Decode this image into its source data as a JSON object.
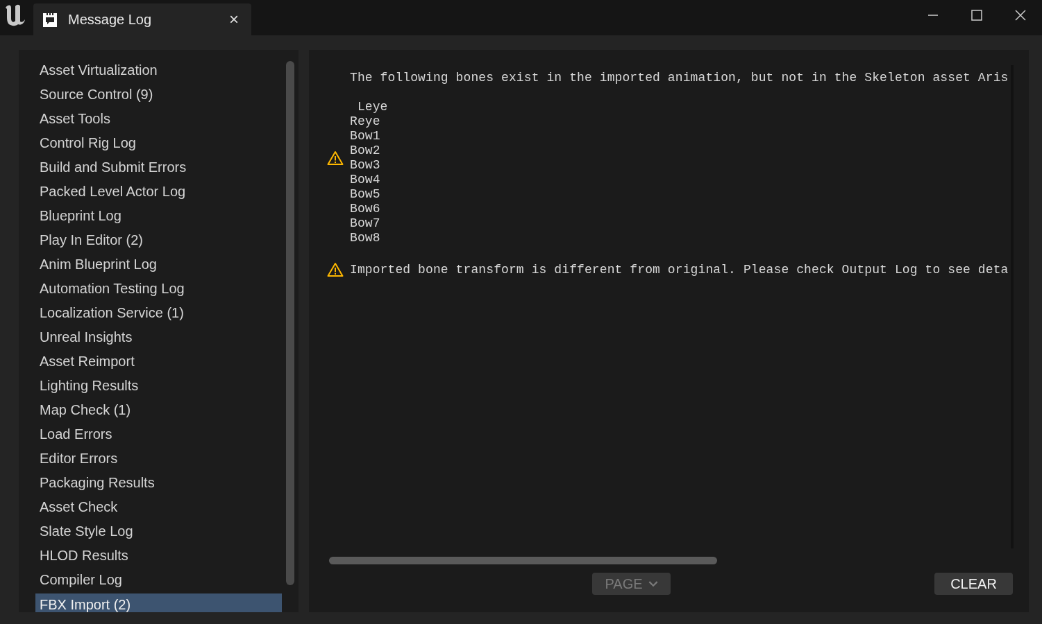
{
  "tab": {
    "title": "Message Log",
    "close": "×"
  },
  "categories": [
    {
      "label": "Asset Virtualization",
      "selected": false
    },
    {
      "label": "Source Control (9)",
      "selected": false
    },
    {
      "label": "Asset Tools",
      "selected": false
    },
    {
      "label": "Control Rig Log",
      "selected": false
    },
    {
      "label": "Build and Submit Errors",
      "selected": false
    },
    {
      "label": "Packed Level Actor Log",
      "selected": false
    },
    {
      "label": "Blueprint Log",
      "selected": false
    },
    {
      "label": "Play In Editor (2)",
      "selected": false
    },
    {
      "label": "Anim Blueprint Log",
      "selected": false
    },
    {
      "label": "Automation Testing Log",
      "selected": false
    },
    {
      "label": "Localization Service (1)",
      "selected": false
    },
    {
      "label": "Unreal Insights",
      "selected": false
    },
    {
      "label": "Asset Reimport",
      "selected": false
    },
    {
      "label": "Lighting Results",
      "selected": false
    },
    {
      "label": "Map Check (1)",
      "selected": false
    },
    {
      "label": "Load Errors",
      "selected": false
    },
    {
      "label": "Editor Errors",
      "selected": false
    },
    {
      "label": "Packaging Results",
      "selected": false
    },
    {
      "label": "Asset Check",
      "selected": false
    },
    {
      "label": "Slate Style Log",
      "selected": false
    },
    {
      "label": "HLOD Results",
      "selected": false
    },
    {
      "label": "Compiler Log",
      "selected": false
    },
    {
      "label": "FBX Import (2)",
      "selected": true
    }
  ],
  "messages": [
    {
      "kind": "warning",
      "text": "The following bones exist in the imported animation, but not in the Skeleton asset Aris\n\n Leye\nReye\nBow1\nBow2\nBow3\nBow4\nBow5\nBow6\nBow7\nBow8"
    },
    {
      "kind": "warning",
      "text": "Imported bone transform is different from original. Please check Output Log to see deta"
    }
  ],
  "page_button": {
    "label": "PAGE",
    "disabled": true
  },
  "clear_button": {
    "label": "CLEAR",
    "disabled": false
  }
}
